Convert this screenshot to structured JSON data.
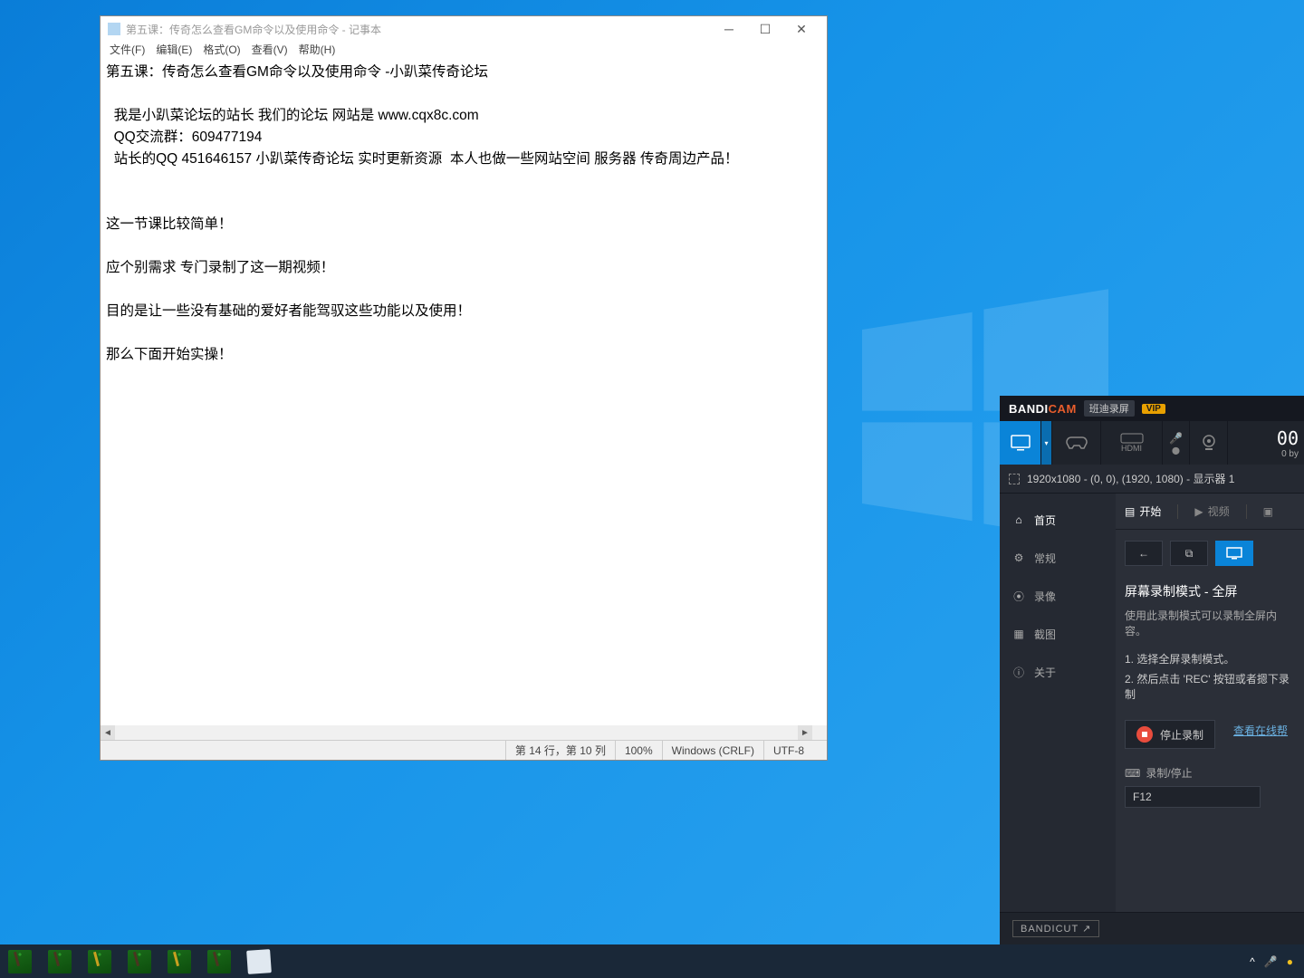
{
  "notepad": {
    "title": "第五课：传奇怎么查看GM命令以及使用命令 - 记事本",
    "menu": {
      "file": "文件(F)",
      "edit": "编辑(E)",
      "format": "格式(O)",
      "view": "查看(V)",
      "help": "帮助(H)"
    },
    "content": "第五课：传奇怎么查看GM命令以及使用命令 -小趴菜传奇论坛\n\n  我是小趴菜论坛的站长 我们的论坛 网站是 www.cqx8c.com\n  QQ交流群：609477194\n  站长的QQ 451646157 小趴菜传奇论坛 实时更新资源  本人也做一些网站空间 服务器 传奇周边产品！\n\n\n这一节课比较简单！\n\n应个别需求 专门录制了这一期视频！\n\n目的是让一些没有基础的爱好者能驾驭这些功能以及使用！\n\n那么下面开始实操！",
    "status": {
      "pos": "第 14 行，第 10 列",
      "zoom": "100%",
      "eol": "Windows (CRLF)",
      "enc": "UTF-8"
    }
  },
  "bandicam": {
    "brand1": "BANDI",
    "brand2": "CAM",
    "sub": "班迪录屏",
    "vip": "VIP",
    "counter": "00",
    "counter_sub": "0 by",
    "capture_info": "1920x1080 - (0, 0), (1920, 1080) - 显示器 1",
    "modes": {
      "hdmi": "HDMI"
    },
    "side": {
      "home": "首页",
      "general": "常规",
      "video": "录像",
      "image": "截图",
      "about": "关于"
    },
    "tabs": {
      "start": "开始",
      "video": "视频"
    },
    "section": {
      "title": "屏幕录制模式 - 全屏",
      "desc": "使用此录制模式可以录制全屏内容。",
      "step1": "1. 选择全屏录制模式。",
      "step2": "2. 然后点击 'REC' 按钮或者摁下录制",
      "stop": "停止录制",
      "link": "查看在线帮"
    },
    "hotkey": {
      "label": "录制/停止",
      "value": "F12"
    },
    "cut": "BANDICUT ↗"
  },
  "taskbar": {
    "items_count": 7
  }
}
